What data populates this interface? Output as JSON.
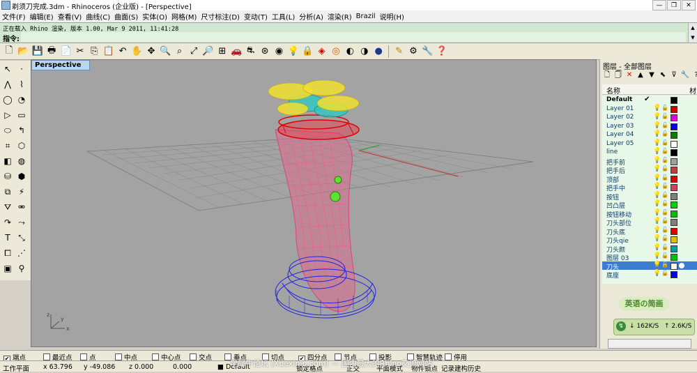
{
  "window": {
    "title": "剃须刀完成.3dm - Rhinoceros (企业版) - [Perspective]",
    "controls": [
      "—",
      "❐",
      "✕"
    ]
  },
  "menu": [
    "文件(F)",
    "编辑(E)",
    "查看(V)",
    "曲线(C)",
    "曲面(S)",
    "实体(O)",
    "网格(M)",
    "尺寸标注(D)",
    "变动(T)",
    "工具(L)",
    "分析(A)",
    "渲染(R)",
    "Brazil",
    "说明(H)"
  ],
  "command": {
    "history_line": "正在载入 Rhino 渲染, 版本 1.00, Mar  9 2011, 11:41:28",
    "prompt_label": "指令:"
  },
  "viewport": {
    "tab_label": "Perspective"
  },
  "layers_panel": {
    "title": "图层 - 全部图层",
    "col_name": "名称",
    "col_material": "材",
    "rows": [
      {
        "name": "Default",
        "color": "#000000",
        "current": true
      },
      {
        "name": "Layer 01",
        "color": "#d00000"
      },
      {
        "name": "Layer 02",
        "color": "#e000e0"
      },
      {
        "name": "Layer 03",
        "color": "#0000e0"
      },
      {
        "name": "Layer 04",
        "color": "#008000"
      },
      {
        "name": "Layer 05",
        "color": "#ffffff"
      },
      {
        "name": "line",
        "color": "#000000"
      },
      {
        "name": "把手前",
        "color": "#a0a0a0"
      },
      {
        "name": "把手后",
        "color": "#c04040"
      },
      {
        "name": "顶部",
        "color": "#e00000"
      },
      {
        "name": "把手中",
        "color": "#d04060"
      },
      {
        "name": "按钮",
        "color": "#808080"
      },
      {
        "name": "凹凸层",
        "color": "#00d000"
      },
      {
        "name": "按钮移动",
        "color": "#00c000"
      },
      {
        "name": "刀头部位",
        "color": "#808080"
      },
      {
        "name": "刀头底",
        "color": "#e00000"
      },
      {
        "name": "刀头qie",
        "color": "#e0c000"
      },
      {
        "name": "刀头颜",
        "color": "#00a0a0"
      },
      {
        "name": "图层 03",
        "color": "#00c000"
      },
      {
        "name": "刀头",
        "color": "#ffffff",
        "selected": true
      },
      {
        "name": "底座",
        "color": "#0000e0"
      }
    ]
  },
  "widget": {
    "logo_text": "英语の简画",
    "download": "↓ 162K/S",
    "upload": "↑ 2.6K/S"
  },
  "osnaps": [
    {
      "label": "端点",
      "checked": true
    },
    {
      "label": "最近点",
      "checked": false
    },
    {
      "label": "点",
      "checked": false
    },
    {
      "label": "中点",
      "checked": false
    },
    {
      "label": "中心点",
      "checked": false
    },
    {
      "label": "交点",
      "checked": false
    },
    {
      "label": "垂点",
      "checked": false
    },
    {
      "label": "切点",
      "checked": false
    },
    {
      "label": "四分点",
      "checked": true
    },
    {
      "label": "节点",
      "checked": false
    },
    {
      "label": "投影",
      "checked": false
    },
    {
      "label": "智慧轨迹",
      "checked": false
    },
    {
      "label": "停用",
      "checked": false
    }
  ],
  "status": {
    "cplane": "工作平面",
    "x": "x 63.796",
    "y": "y -49.086",
    "z": "z 0.000",
    "dist": "0.000",
    "layer": "■ Default",
    "snap": "锁定格点",
    "ortho": "正交",
    "planar": "平面模式",
    "osnap": "物件锁点",
    "history": "记录建构历史"
  },
  "watermark": "学犀牛论坛 (Xuexiniu.com) — 国内最大的Rhino交流网站"
}
